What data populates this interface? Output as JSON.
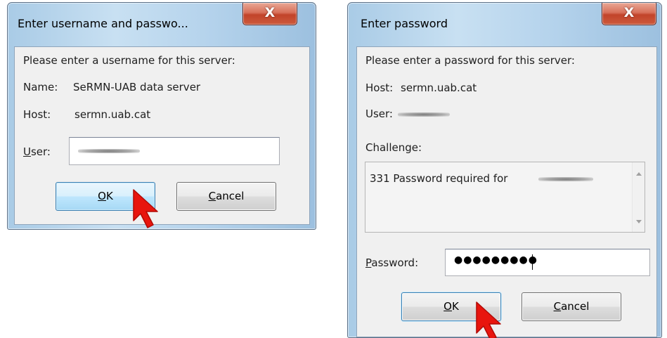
{
  "dialog_user": {
    "title": "Enter username and passwo...",
    "close": "X",
    "prompt": "Please enter a username for this server:",
    "name_label": "Name:",
    "name_value": "SeRMN-UAB data server",
    "host_label": "Host:",
    "host_value": "sermn.uab.cat",
    "user_label_accel": "U",
    "user_label_rest": "ser:",
    "ok_accel": "O",
    "ok_rest": "K",
    "cancel_accel": "C",
    "cancel_rest": "ancel"
  },
  "dialog_password": {
    "title": "Enter password",
    "close": "X",
    "prompt": "Please enter a password for this server:",
    "host_label": "Host:",
    "host_value": "sermn.uab.cat",
    "user_label": "User:",
    "challenge_label": "Challenge:",
    "challenge_text": "331 Password required for",
    "password_label_accel": "P",
    "password_label_rest": "assword:",
    "password_value": "●●●●●●●●●",
    "ok_accel": "O",
    "ok_rest": "K",
    "cancel_accel": "C",
    "cancel_rest": "ancel"
  },
  "colors": {
    "cursor": "#e8150e",
    "accent": "#3c7fb1"
  },
  "icons": [
    "close-icon",
    "scroll-up-icon",
    "scroll-down-icon",
    "mouse-pointer-icon"
  ]
}
